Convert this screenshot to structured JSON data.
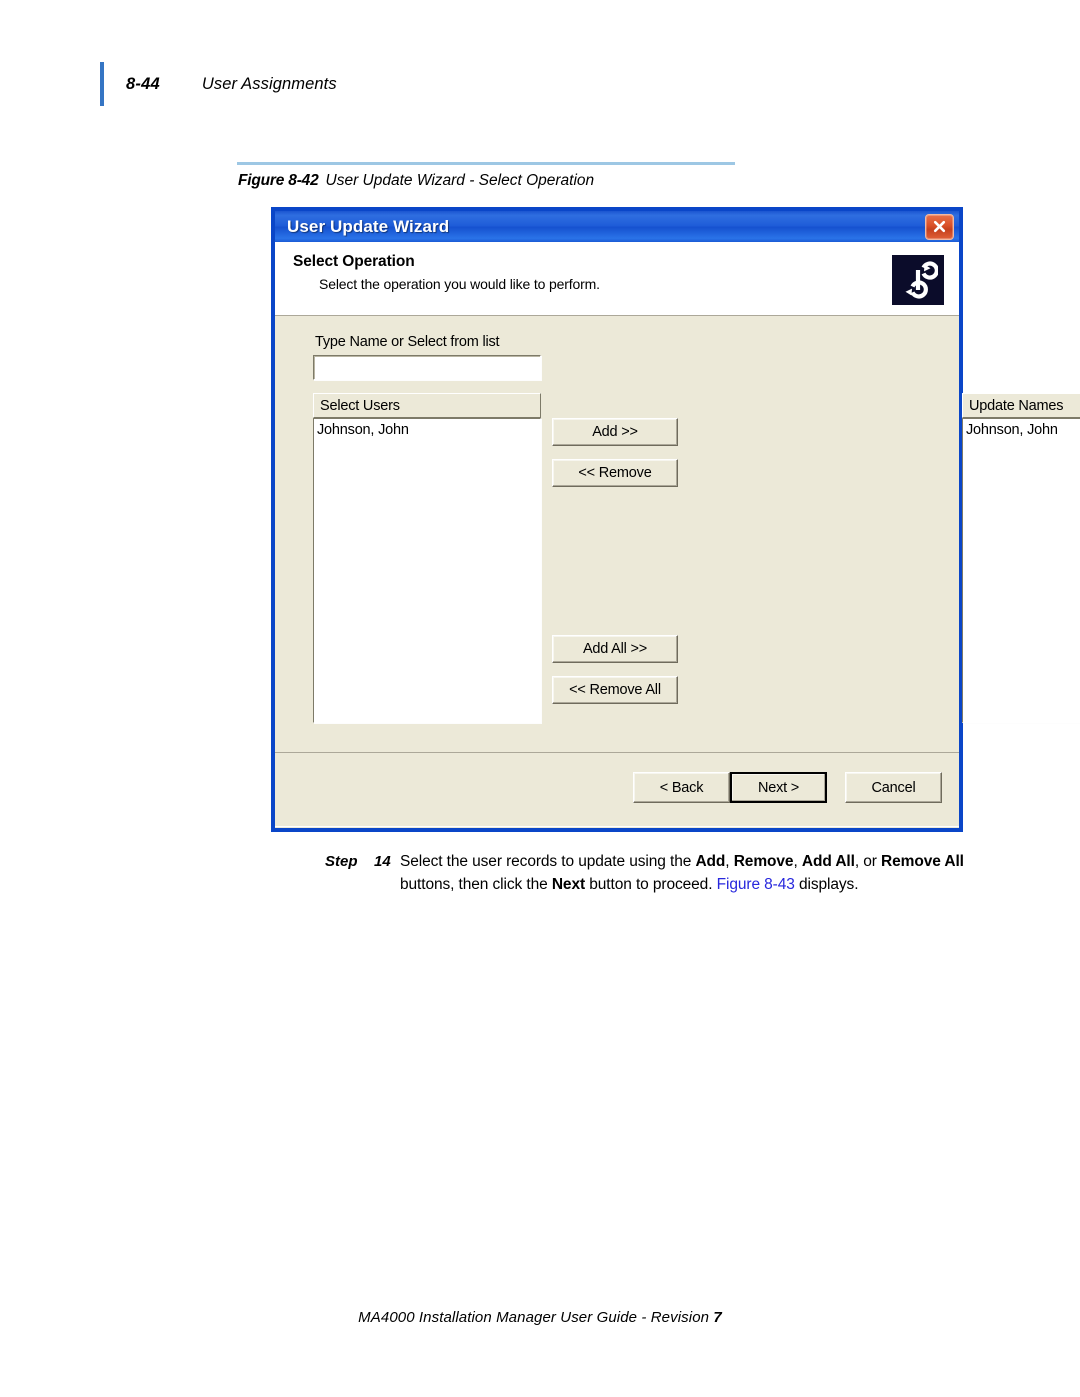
{
  "page": {
    "folio": "8-44",
    "running_head": "User Assignments",
    "footer_prefix": "MA4000 Installation Manager User Guide - Revision",
    "footer_revision": "7"
  },
  "figure": {
    "label": "Figure 8-42",
    "caption": "User Update Wizard - Select Operation"
  },
  "dialog": {
    "title": "User Update Wizard",
    "close_icon": "close-icon",
    "header": {
      "heading": "Select Operation",
      "subheading": "Select the operation you would like to perform.",
      "logo_icon": "refresh-sync-icon"
    },
    "form": {
      "name_field_label": "Type Name or Select from list",
      "name_field_value": "",
      "name_field_placeholder": ""
    },
    "select_users": {
      "header": "Select Users",
      "items": [
        "Johnson, John"
      ]
    },
    "update_names": {
      "header": "Update Names",
      "items": [
        "Johnson, John"
      ]
    },
    "transfer_buttons": {
      "add": "Add >>",
      "remove": "<< Remove",
      "add_all": "Add All >>",
      "remove_all": "<< Remove All"
    },
    "nav_buttons": {
      "back": "< Back",
      "next": "Next >",
      "cancel": "Cancel"
    }
  },
  "step": {
    "label": "Step",
    "number": "14",
    "text_1": "Select the user records to update using the ",
    "b_add": "Add",
    "text_2": ", ",
    "b_remove": "Remove",
    "text_3": ", ",
    "b_add_all": "Add All",
    "text_4": ", or ",
    "b_remove_all": "Remove All",
    "text_5": " buttons, then click the ",
    "b_next": "Next",
    "text_6": " button to proceed. ",
    "link_figure": "Figure 8-43",
    "text_7": " displays."
  },
  "colors": {
    "titlebar_blue": "#1e5cd8",
    "dialog_border": "#0a46c8",
    "face": "#ece9d8",
    "rule_blue": "#9dc7e4",
    "marker_blue": "#3575c4",
    "link_blue": "#2727dd",
    "close_red": "#d94f27",
    "logo_bg": "#0b0c2a"
  }
}
